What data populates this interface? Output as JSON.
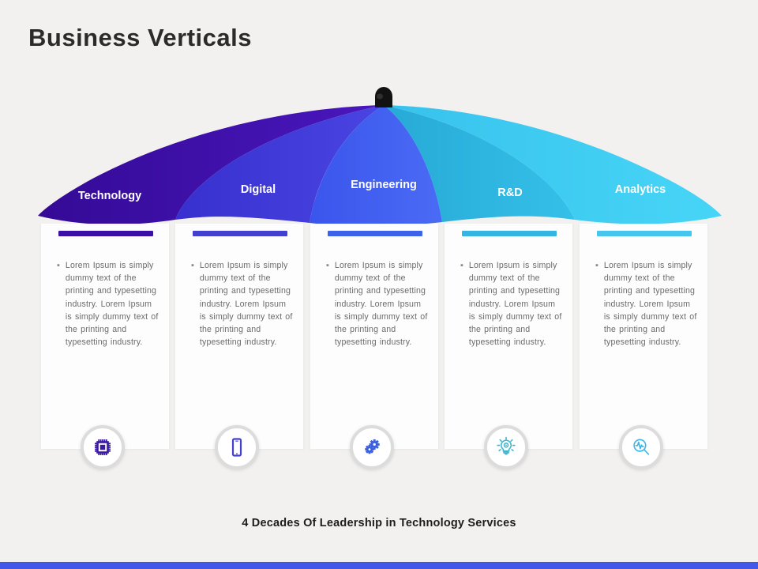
{
  "slide": {
    "title": "Business Verticals",
    "footer": "4 Decades Of Leadership in Technology Services",
    "background_color": "#f2f1ef",
    "bottom_bar_color": "#4158e8",
    "title_color": "#2b2b2b"
  },
  "umbrella": {
    "finial_color": "#121212",
    "panels": [
      {
        "label": "Technology",
        "color": "#3c0ea8",
        "color_light": "#4a17bd"
      },
      {
        "label": "Digital",
        "color": "#3b36d6",
        "color_light": "#4a45e2"
      },
      {
        "label": "Engineering",
        "color": "#3d5cf0",
        "color_light": "#4a6bf5"
      },
      {
        "label": "R&D",
        "color": "#2bb2dd",
        "color_light": "#31bde6"
      },
      {
        "label": "Analytics",
        "color": "#3cc8ef",
        "color_light": "#45d2f5"
      }
    ]
  },
  "columns": [
    {
      "label": "Technology",
      "accent_color": "#3c0ea8",
      "icon": "cpu-chip-icon",
      "icon_color": "#3b1aa3",
      "bullets": [
        "Lorem Ipsum is simply dummy text of the printing and typesetting industry. Lorem Ipsum is simply dummy text of the printing and typesetting industry."
      ]
    },
    {
      "label": "Digital",
      "accent_color": "#4340cf",
      "icon": "smartphone-icon",
      "icon_color": "#4340cf",
      "bullets": [
        "Lorem Ipsum is simply dummy text of the printing and typesetting industry. Lorem Ipsum is simply dummy text of the printing and typesetting industry."
      ]
    },
    {
      "label": "Engineering",
      "accent_color": "#3d63ea",
      "icon": "gears-icon",
      "icon_color": "#3a5fe0",
      "bullets": [
        "Lorem Ipsum is simply dummy text of the printing and typesetting industry. Lorem Ipsum is simply dummy text of the printing and typesetting industry."
      ]
    },
    {
      "label": "R&D",
      "accent_color": "#35b5e2",
      "icon": "lightbulb-gear-icon",
      "icon_color": "#3fb5cf",
      "bullets": [
        "Lorem Ipsum is simply dummy text of the printing and typesetting industry. Lorem Ipsum is simply dummy text of the printing and typesetting industry."
      ]
    },
    {
      "label": "Analytics",
      "accent_color": "#46c6ee",
      "icon": "magnifier-pulse-icon",
      "icon_color": "#39b6e8",
      "bullets": [
        "Lorem Ipsum is simply dummy text of the printing and typesetting industry. Lorem Ipsum is simply dummy text of the printing and typesetting industry."
      ]
    }
  ]
}
